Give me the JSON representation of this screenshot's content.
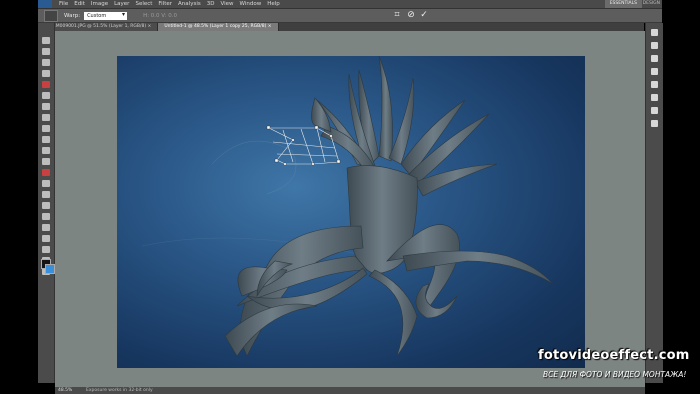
{
  "menubar": {
    "items": [
      "File",
      "Edit",
      "Image",
      "Layer",
      "Select",
      "Filter",
      "Analysis",
      "3D",
      "View",
      "Window",
      "Help"
    ],
    "workspace_button": "ESSENTIALS",
    "workspace_alt": "DESIGN"
  },
  "options": {
    "warp_label": "Warp:",
    "warp_value": "Custom",
    "ghost_fields": "H: 0.0   V: 0.0"
  },
  "tabs": [
    {
      "label": "04M009001.JPG @ 51.5% (Layer 1, RGB/8) ×"
    },
    {
      "label": "Untitled-1 @ 48.5% (Layer 1 copy 25, RGB/8) ×"
    }
  ],
  "status": {
    "zoom": "48.5%",
    "docinfo": "Exposure works in 32-bit only"
  },
  "watermark": {
    "title": "fotovideoeffect.com",
    "subtitle": "ВСЕ ДЛЯ ФОТО И ВИДЕО МОНТАЖА!"
  },
  "colors": {
    "canvas_bg": "#1f4775",
    "tree_fill": "#5c6a73",
    "accent_blue": "#3b8fd8"
  },
  "icons": {
    "commit": "checkmark-icon",
    "cancel": "cancel-icon",
    "warp_toggle": "warp-mode-icon"
  }
}
